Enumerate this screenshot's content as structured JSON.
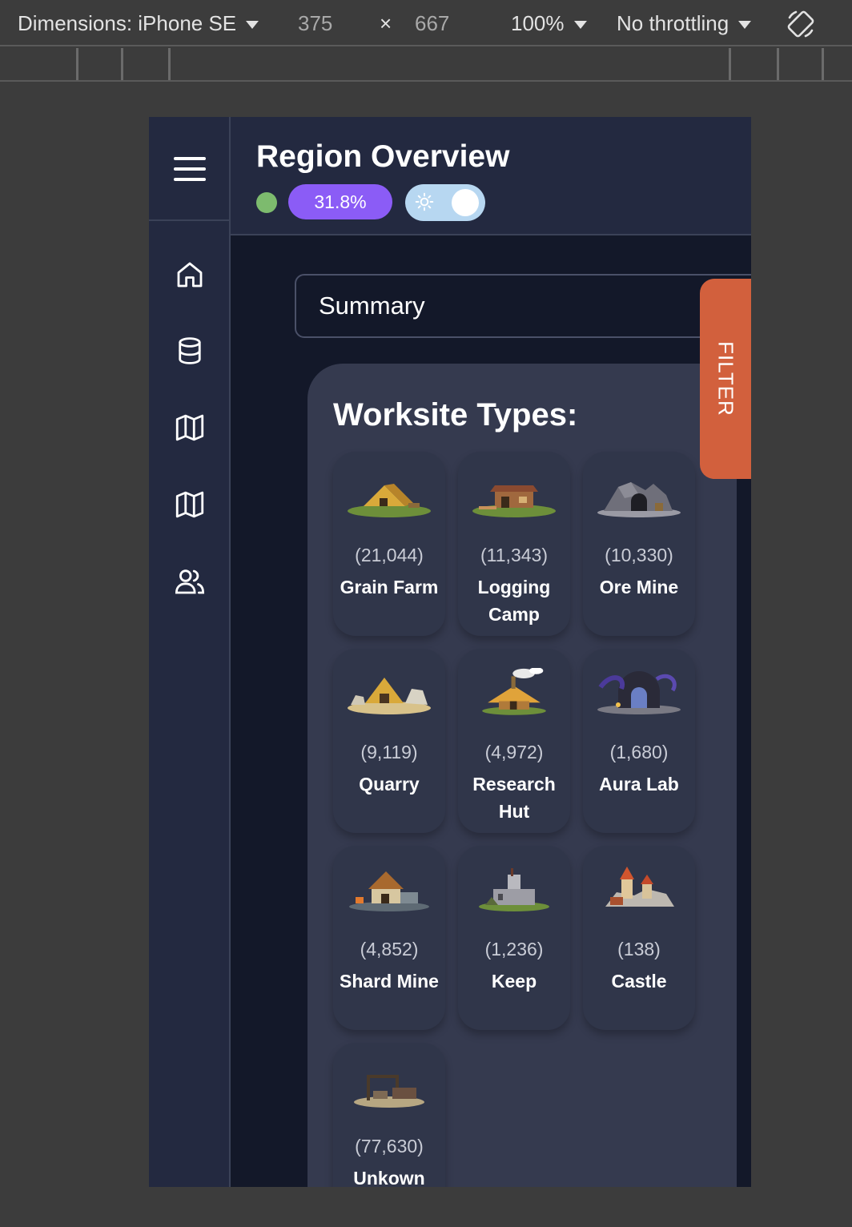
{
  "devtools": {
    "dimensions_label": "Dimensions: iPhone SE",
    "width": "375",
    "times": "×",
    "height": "667",
    "zoom": "100%",
    "throttling": "No throttling"
  },
  "header": {
    "title": "Region Overview",
    "percent_badge": "31.8%"
  },
  "sidebar": {
    "items": [
      {
        "icon": "home-icon"
      },
      {
        "icon": "database-icon"
      },
      {
        "icon": "map-icon"
      },
      {
        "icon": "map-icon"
      },
      {
        "icon": "users-icon"
      }
    ]
  },
  "summary_select": {
    "value": "Summary"
  },
  "filter_tab": {
    "label": "FILTER"
  },
  "panel": {
    "title": "Worksite Types:",
    "cards": [
      {
        "count": "(21,044)",
        "name": "Grain Farm"
      },
      {
        "count": "(11,343)",
        "name": "Logging Camp"
      },
      {
        "count": "(10,330)",
        "name": "Ore Mine"
      },
      {
        "count": "(9,119)",
        "name": "Quarry"
      },
      {
        "count": "(4,972)",
        "name": "Research Hut"
      },
      {
        "count": "(1,680)",
        "name": "Aura Lab"
      },
      {
        "count": "(4,852)",
        "name": "Shard Mine"
      },
      {
        "count": "(1,236)",
        "name": "Keep"
      },
      {
        "count": "(138)",
        "name": "Castle"
      },
      {
        "count": "(77,630)",
        "name": "Unkown"
      }
    ]
  },
  "colors": {
    "accent_purple": "#8b5cf6",
    "filter_orange": "#d2603d",
    "status_green": "#7dbb6e",
    "toggle_blue": "#b7d7f1"
  }
}
